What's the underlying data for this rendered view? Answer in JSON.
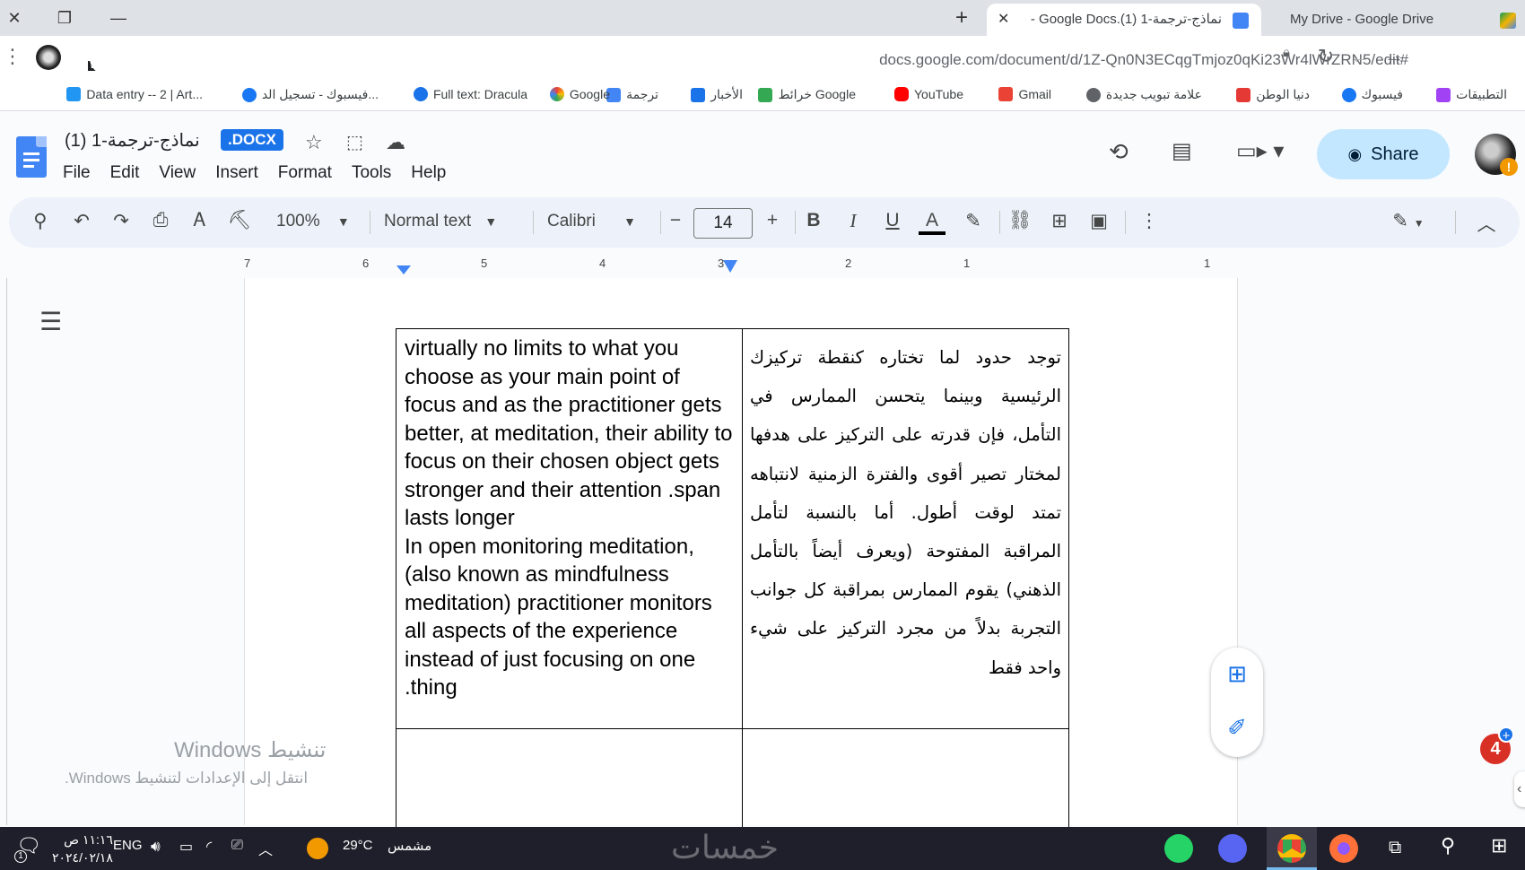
{
  "browser": {
    "tabs": [
      {
        "title": "My Drive - Google Drive",
        "active": false
      },
      {
        "title": "نماذج-ترجمة-1 (1).Google Docs -",
        "active": true
      }
    ],
    "new_tab_icon": "+",
    "url": "docs.google.com/document/d/1Z-Qn0N3ECqgTmjoz0qKi23Wr4lWrZRN5/edit#",
    "beta_label": "BETA",
    "bookmarks": [
      {
        "label": "التطبيقات",
        "color": "#a142f4"
      },
      {
        "label": "فيسبوك",
        "color": "#1877f2"
      },
      {
        "label": "دنيا الوطن",
        "color": "#e53935"
      },
      {
        "label": "علامة تبويب جديدة",
        "color": "#5f6368"
      },
      {
        "label": "Gmail",
        "color": "#ea4335"
      },
      {
        "label": "YouTube",
        "color": "#ff0000"
      },
      {
        "label": "خرائط Google",
        "color": "#34a853"
      },
      {
        "label": "الأخبار",
        "color": "#1a73e8"
      },
      {
        "label": "ترجمة",
        "color": "#4285f4"
      },
      {
        "label": "Google",
        "color": "#4285f4"
      },
      {
        "label": "Full text: Dracula",
        "color": "#1a73e8"
      },
      {
        "label": "فيسبوك - تسجيل الد...",
        "color": "#1877f2"
      },
      {
        "label": "Data entry -- 2 | Art...",
        "color": "#2196f3"
      }
    ]
  },
  "docs": {
    "title": "نماذج-ترجمة-1 (1)",
    "format_badge": ".DOCX",
    "menu": [
      "File",
      "Edit",
      "View",
      "Insert",
      "Format",
      "Tools",
      "Help"
    ],
    "share_label": "Share",
    "avatar_badge": "!",
    "toolbar": {
      "zoom": "100%",
      "style": "Normal text",
      "font": "Calibri",
      "font_size": "14",
      "bold": "B",
      "italic": "I",
      "underline": "U",
      "text_color": "A"
    },
    "ruler_numbers": [
      "7",
      "6",
      "5",
      "4",
      "3",
      "2",
      "1",
      "1"
    ],
    "table": {
      "english_text": "virtually no limits to what you choose as your main point of focus and as the practitioner gets better, at meditation, their ability to focus on their chosen object gets stronger and their attention .span lasts longer\nIn open monitoring meditation, (also known as mindfulness meditation) practitioner monitors all aspects of the experience instead of just focusing on one .thing",
      "arabic_text": "توجد حدود لما تختاره كنقطة تركيزك الرئيسية وبينما يتحسن الممارس في التأمل، فإن قدرته على التركيز على هدفها لمختار تصير أقوى والفترة الزمنية لانتباهه تمتد لوقت أطول. أما بالنسبة لتأمل المراقبة المفتوحة (ويعرف أيضاً بالتأمل الذهني) يقوم الممارس بمراقبة كل جوانب التجربة بدلاً من مجرد التركيز على شيء واحد فقط"
    },
    "notification_count": "4"
  },
  "windows": {
    "watermark_title": "تنشيط Windows",
    "watermark_sub": "انتقل إلى الإعدادات لتنشيط Windows.",
    "taskbar": {
      "time": "١١:١٦ ص",
      "date": "٢٠٢٤/٠٢/١٨",
      "language": "ENG",
      "weather_temp": "29°C",
      "weather_text": "مشمس",
      "logo_text": "خمسات",
      "chat_badge": "1"
    }
  }
}
